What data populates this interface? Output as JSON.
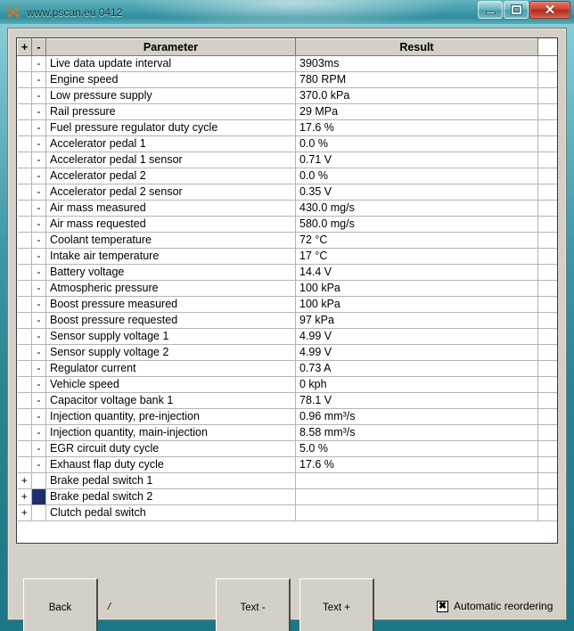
{
  "window": {
    "title": "www.pscan.eu 0412",
    "icon": "pscan-butterfly-icon",
    "minimize_label": "–",
    "maximize_label": "□",
    "close_label": "✕",
    "frame_color": "#2b8593"
  },
  "grid": {
    "columns": {
      "expand": "+",
      "collapse": "-",
      "parameter": "Parameter",
      "result": "Result"
    },
    "selection": {
      "row_index": 27,
      "column": "collapse",
      "color": "#1c2f6b"
    },
    "rows": [
      {
        "sig": "-",
        "parameter": "Live data update interval",
        "result": "3903ms"
      },
      {
        "sig": "-",
        "parameter": "Engine speed",
        "result": "780 RPM"
      },
      {
        "sig": "-",
        "parameter": "Low pressure supply",
        "result": "370.0 kPa"
      },
      {
        "sig": "-",
        "parameter": "Rail pressure",
        "result": "29 MPa"
      },
      {
        "sig": "-",
        "parameter": "Fuel pressure regulator duty cycle",
        "result": "17.6 %"
      },
      {
        "sig": "-",
        "parameter": "Accelerator pedal 1",
        "result": "0.0 %"
      },
      {
        "sig": "-",
        "parameter": "Accelerator pedal 1 sensor",
        "result": "0.71 V"
      },
      {
        "sig": "-",
        "parameter": "Accelerator pedal 2",
        "result": "0.0 %"
      },
      {
        "sig": "-",
        "parameter": "Accelerator pedal 2 sensor",
        "result": "0.35 V"
      },
      {
        "sig": "-",
        "parameter": "Air mass measured",
        "result": "430.0 mg/s"
      },
      {
        "sig": "-",
        "parameter": "Air mass requested",
        "result": "580.0 mg/s"
      },
      {
        "sig": "-",
        "parameter": "Coolant temperature",
        "result": "72 °C"
      },
      {
        "sig": "-",
        "parameter": "Intake air temperature",
        "result": "17 °C"
      },
      {
        "sig": "-",
        "parameter": "Battery voltage",
        "result": "14.4 V"
      },
      {
        "sig": "-",
        "parameter": "Atmospheric pressure",
        "result": "100 kPa"
      },
      {
        "sig": "-",
        "parameter": "Boost pressure measured",
        "result": "100 kPa"
      },
      {
        "sig": "-",
        "parameter": "Boost pressure requested",
        "result": "97 kPa"
      },
      {
        "sig": "-",
        "parameter": "Sensor supply voltage 1",
        "result": "4.99 V"
      },
      {
        "sig": "-",
        "parameter": "Sensor supply voltage 2",
        "result": "4.99 V"
      },
      {
        "sig": "-",
        "parameter": "Regulator current",
        "result": "0.73 A"
      },
      {
        "sig": "-",
        "parameter": "Vehicle speed",
        "result": "0 kph"
      },
      {
        "sig": "-",
        "parameter": "Capacitor voltage bank 1",
        "result": "78.1 V"
      },
      {
        "sig": "-",
        "parameter": "Injection quantity, pre-injection",
        "result": "0.96 mm³/s"
      },
      {
        "sig": "-",
        "parameter": "Injection quantity, main-injection",
        "result": "8.58 mm³/s"
      },
      {
        "sig": "-",
        "parameter": "EGR circuit duty cycle",
        "result": "5.0 %"
      },
      {
        "sig": "-",
        "parameter": "Exhaust flap duty cycle",
        "result": "17.6 %"
      },
      {
        "plus": "+",
        "sig": "",
        "parameter": "Brake pedal switch 1",
        "result": ""
      },
      {
        "plus": "+",
        "sig": "",
        "parameter": "Brake pedal switch 2",
        "result": ""
      },
      {
        "plus": "+",
        "sig": "",
        "parameter": "Clutch pedal switch",
        "result": ""
      }
    ]
  },
  "footer": {
    "back_label": "Back",
    "separator_label": "/",
    "text_minus_label": "Text -",
    "text_plus_label": "Text +",
    "reorder_label": "Automatic reordering",
    "reorder_checked_mark": "✖",
    "reorder_checked": true
  }
}
